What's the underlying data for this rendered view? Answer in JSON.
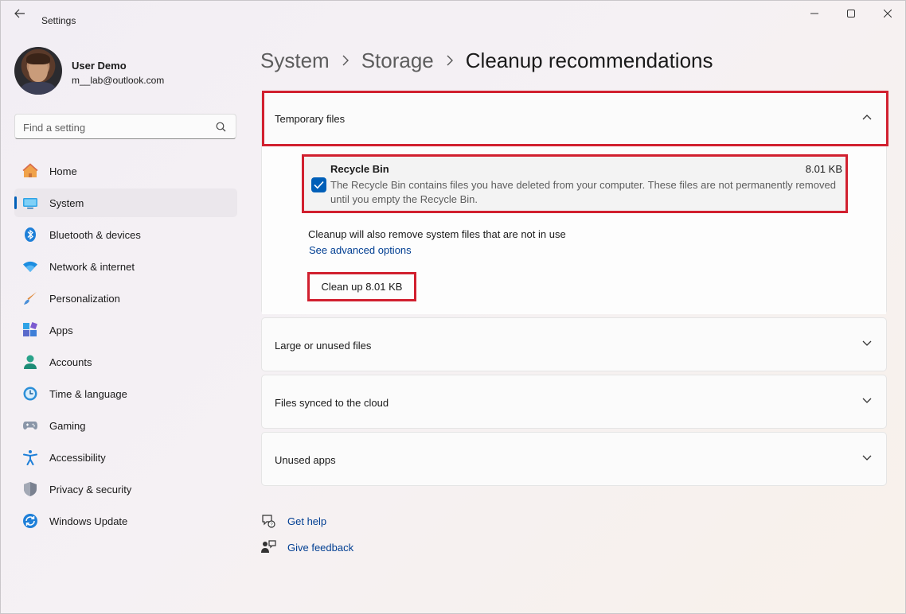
{
  "window": {
    "title": "Settings"
  },
  "profile": {
    "name": "User Demo",
    "email": "m__lab@outlook.com"
  },
  "search": {
    "placeholder": "Find a setting"
  },
  "sidebar": {
    "items": [
      {
        "label": "Home",
        "icon": "home-icon"
      },
      {
        "label": "System",
        "icon": "system-icon",
        "active": true
      },
      {
        "label": "Bluetooth & devices",
        "icon": "bluetooth-icon"
      },
      {
        "label": "Network & internet",
        "icon": "wifi-icon"
      },
      {
        "label": "Personalization",
        "icon": "brush-icon"
      },
      {
        "label": "Apps",
        "icon": "apps-icon"
      },
      {
        "label": "Accounts",
        "icon": "accounts-icon"
      },
      {
        "label": "Time & language",
        "icon": "time-language-icon"
      },
      {
        "label": "Gaming",
        "icon": "gamepad-icon"
      },
      {
        "label": "Accessibility",
        "icon": "accessibility-icon"
      },
      {
        "label": "Privacy & security",
        "icon": "shield-icon"
      },
      {
        "label": "Windows Update",
        "icon": "update-icon"
      }
    ]
  },
  "breadcrumb": {
    "items": [
      "System",
      "Storage",
      "Cleanup recommendations"
    ]
  },
  "sections": {
    "temporary": {
      "title": "Temporary files",
      "expanded": true,
      "recycle_bin": {
        "title": "Recycle Bin",
        "size": "8.01 KB",
        "checked": true,
        "description": "The Recycle Bin contains files you have deleted from your computer. These files are not permanently removed until you empty the Recycle Bin."
      },
      "note": "Cleanup will also remove system files that are not in use",
      "advanced_link": "See advanced options",
      "cleanup_button": "Clean up 8.01 KB"
    },
    "large": {
      "title": "Large or unused files"
    },
    "cloud": {
      "title": "Files synced to the cloud"
    },
    "unused_apps": {
      "title": "Unused apps"
    }
  },
  "help": {
    "get_help": "Get help",
    "give_feedback": "Give feedback"
  },
  "colors": {
    "accent": "#005fb8",
    "highlight": "#d1202f",
    "link": "#003e92"
  }
}
